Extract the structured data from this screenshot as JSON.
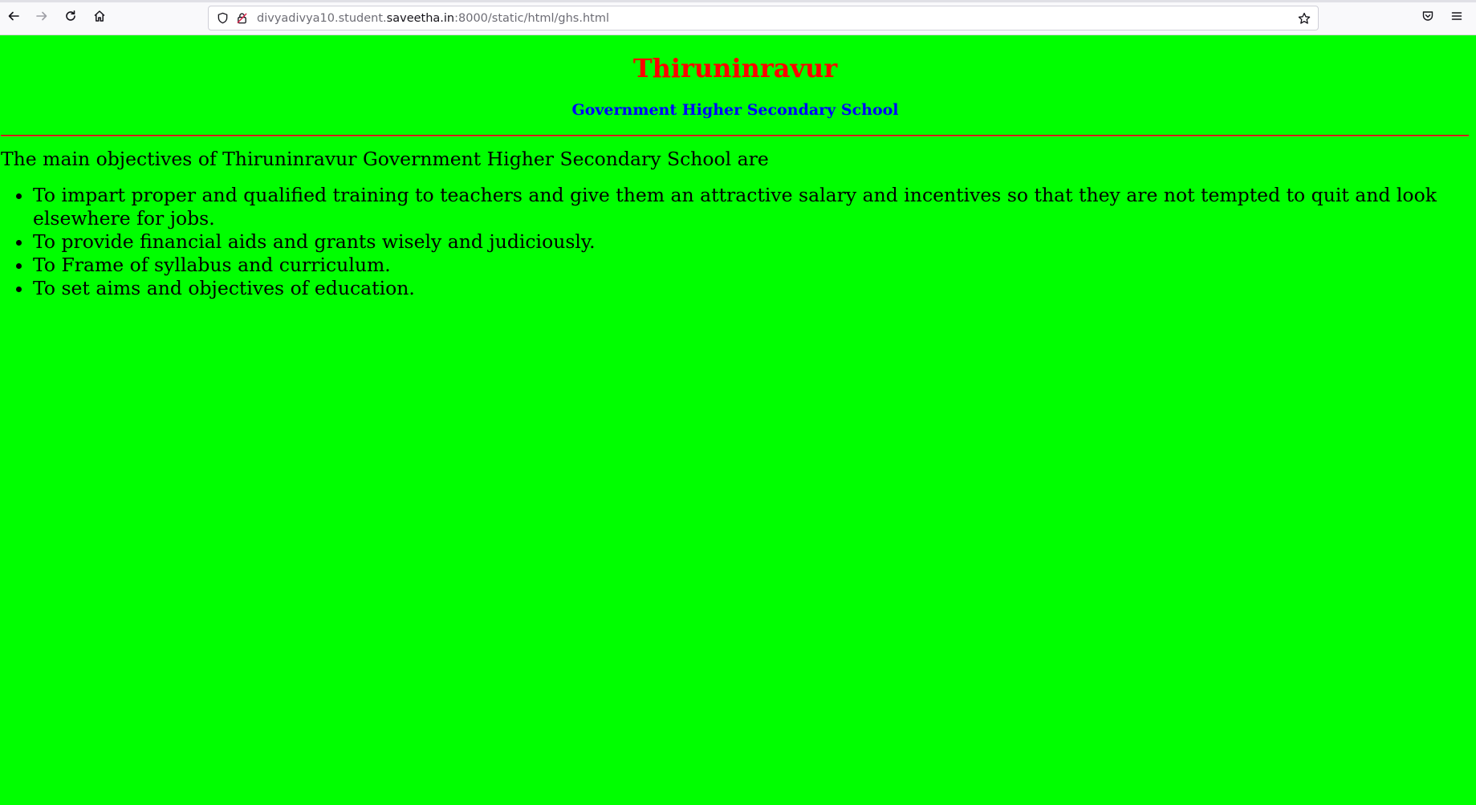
{
  "browser": {
    "url_prefix": "divyadivya10.student.",
    "url_domain": "saveetha.in",
    "url_suffix": ":8000/static/html/ghs.html"
  },
  "page": {
    "title": "Thiruninravur",
    "subtitle": "Government Higher Secondary School",
    "intro": "The main objectives of Thiruninravur Government Higher Secondary School are",
    "objectives": [
      "To impart proper and qualified training to teachers and give them an attractive salary and incentives so that they are not tempted to quit and look elsewhere for jobs.",
      "To provide financial aids and grants wisely and judiciously.",
      "To Frame of syllabus and curriculum.",
      "To set aims and objectives of education."
    ]
  },
  "colors": {
    "background": "#00ff00",
    "title": "#ff0000",
    "subtitle": "#0000ff",
    "divider": "#cc0000"
  }
}
